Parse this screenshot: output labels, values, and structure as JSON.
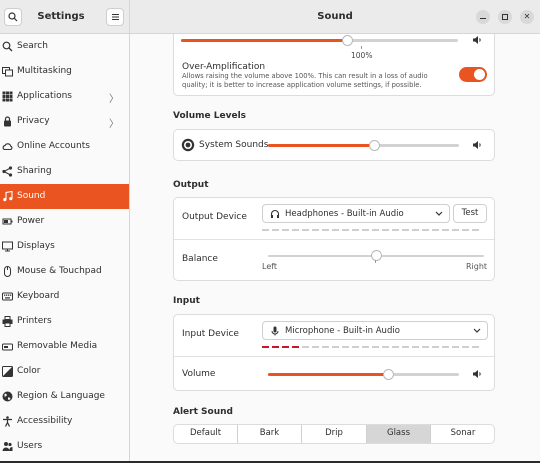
{
  "sidebar": {
    "title": "Settings",
    "items": [
      {
        "label": "Search",
        "icon": "search-icon",
        "chevron": false
      },
      {
        "label": "Multitasking",
        "icon": "multitasking-icon",
        "chevron": false
      },
      {
        "label": "Applications",
        "icon": "applications-icon",
        "chevron": true
      },
      {
        "label": "Privacy",
        "icon": "privacy-icon",
        "chevron": true
      },
      {
        "label": "Online Accounts",
        "icon": "cloud-icon",
        "chevron": false
      },
      {
        "label": "Sharing",
        "icon": "share-icon",
        "chevron": false
      },
      {
        "label": "Sound",
        "icon": "music-note-icon",
        "chevron": false,
        "active": true
      },
      {
        "label": "Power",
        "icon": "power-icon",
        "chevron": false
      },
      {
        "label": "Displays",
        "icon": "display-icon",
        "chevron": false
      },
      {
        "label": "Mouse & Touchpad",
        "icon": "mouse-icon",
        "chevron": false
      },
      {
        "label": "Keyboard",
        "icon": "keyboard-icon",
        "chevron": false
      },
      {
        "label": "Printers",
        "icon": "printer-icon",
        "chevron": false
      },
      {
        "label": "Removable Media",
        "icon": "removable-media-icon",
        "chevron": false
      },
      {
        "label": "Color",
        "icon": "color-icon",
        "chevron": false
      },
      {
        "label": "Region & Language",
        "icon": "globe-icon",
        "chevron": false
      },
      {
        "label": "Accessibility",
        "icon": "accessibility-icon",
        "chevron": false
      },
      {
        "label": "Users",
        "icon": "users-icon",
        "chevron": false
      }
    ]
  },
  "header": {
    "title": "Sound"
  },
  "top_volume": {
    "percent_label": "100%",
    "fraction": 0.6
  },
  "over_amplification": {
    "title": "Over-Amplification",
    "description": "Allows raising the volume above 100%. This can result in a loss of audio quality; it is better to increase application volume settings, if possible.",
    "enabled": true
  },
  "volume_levels": {
    "section_title": "Volume Levels",
    "system_sounds_label": "System Sounds",
    "fraction": 0.55
  },
  "output": {
    "section_title": "Output",
    "device_label": "Output Device",
    "device_value": "Headphones - Built-in Audio",
    "test_label": "Test",
    "balance_label": "Balance",
    "balance_left": "Left",
    "balance_right": "Right",
    "balance_fraction": 0.5
  },
  "input": {
    "section_title": "Input",
    "device_label": "Input Device",
    "device_value": "Microphone - Built-in Audio",
    "volume_label": "Volume",
    "volume_fraction": 0.63,
    "level_fraction": 0.2
  },
  "alert_sound": {
    "section_title": "Alert Sound",
    "options": [
      "Default",
      "Bark",
      "Drip",
      "Glass",
      "Sonar"
    ],
    "selected": "Glass"
  },
  "colors": {
    "accent": "#e95420"
  }
}
